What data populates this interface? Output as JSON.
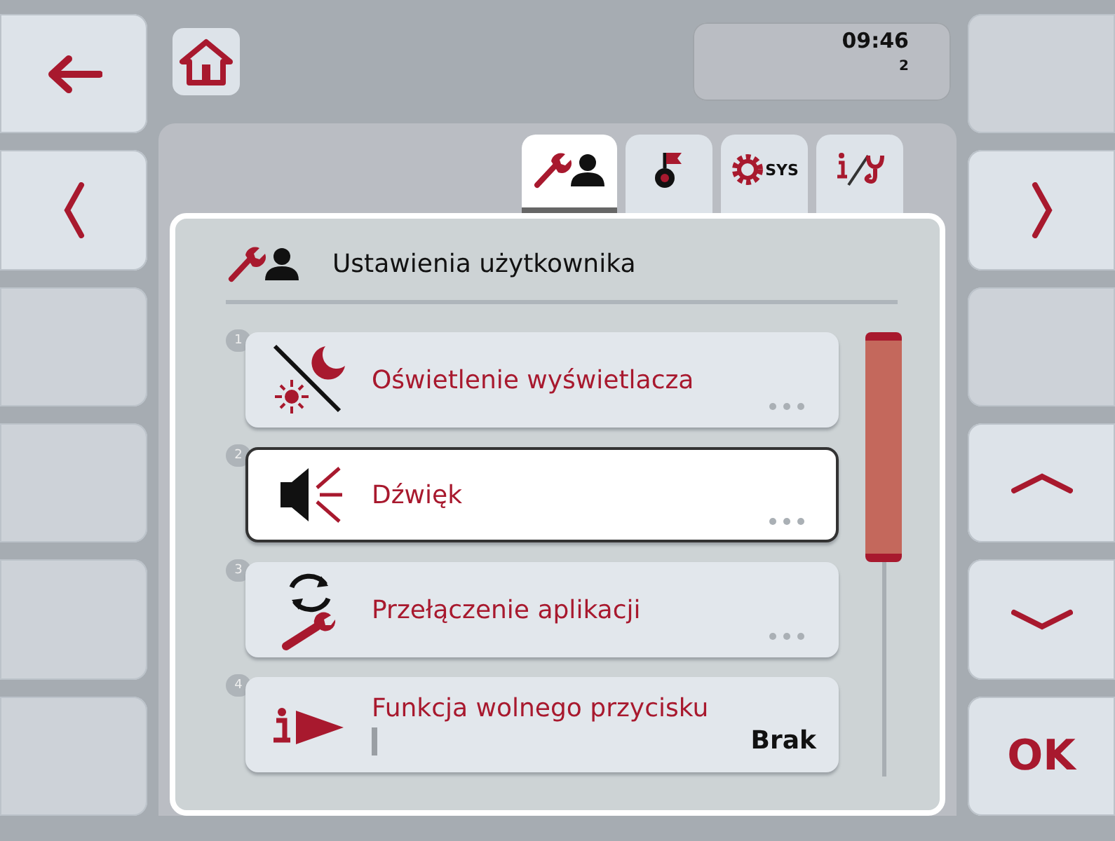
{
  "left_softkeys": [
    {
      "kind": "back"
    },
    {
      "kind": "prev"
    },
    {
      "kind": "empty"
    },
    {
      "kind": "empty"
    },
    {
      "kind": "empty"
    },
    {
      "kind": "empty"
    }
  ],
  "right_softkeys": [
    {
      "kind": "empty"
    },
    {
      "kind": "next"
    },
    {
      "kind": "empty"
    },
    {
      "kind": "up"
    },
    {
      "kind": "down"
    },
    {
      "kind": "ok",
      "label": "OK"
    }
  ],
  "status": {
    "time": "09:46",
    "counter": "2"
  },
  "tabs": [
    {
      "kind": "user",
      "selected": true
    },
    {
      "kind": "country",
      "selected": false
    },
    {
      "kind": "sys",
      "label": "SYS",
      "selected": false
    },
    {
      "kind": "info",
      "selected": false
    }
  ],
  "panel": {
    "title": "Ustawienia użytkownika"
  },
  "rows": [
    {
      "number": "1",
      "kind": "display",
      "title": "Oświetlenie wyświetlacza",
      "selected": false
    },
    {
      "number": "2",
      "kind": "sound",
      "title": "Dźwięk",
      "selected": true
    },
    {
      "number": "3",
      "kind": "switch",
      "title": "Przełączenie aplikacji",
      "selected": false
    },
    {
      "number": "4",
      "kind": "freekey",
      "title": "Funkcja wolnego przycisku",
      "value": "Brak",
      "selected": false
    }
  ]
}
